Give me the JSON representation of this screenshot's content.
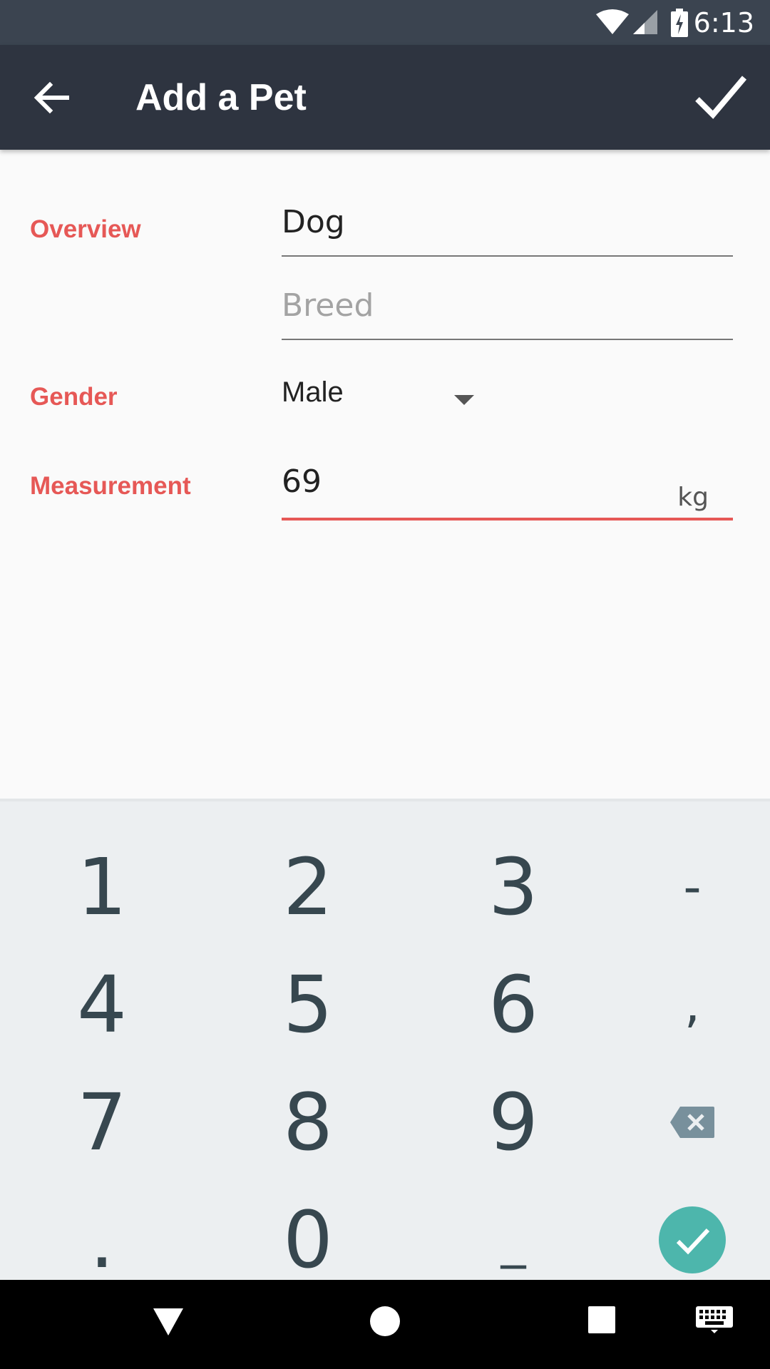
{
  "status": {
    "time": "6:13"
  },
  "app_bar": {
    "title": "Add a Pet"
  },
  "form": {
    "overview_label": "Overview",
    "pet_type_value": "Dog",
    "breed_placeholder": "Breed",
    "gender_label": "Gender",
    "gender_value": "Male",
    "measurement_label": "Measurement",
    "measurement_value": "69",
    "measurement_unit": "kg"
  },
  "keyboard": {
    "keys": [
      "1",
      "2",
      "3",
      "-",
      "4",
      "5",
      "6",
      ",",
      "7",
      "8",
      "9",
      "",
      ".",
      "0",
      "_",
      ""
    ]
  },
  "colors": {
    "accent": "#e65856",
    "app_bar": "#2e3440",
    "fab": "#4db6ac"
  }
}
